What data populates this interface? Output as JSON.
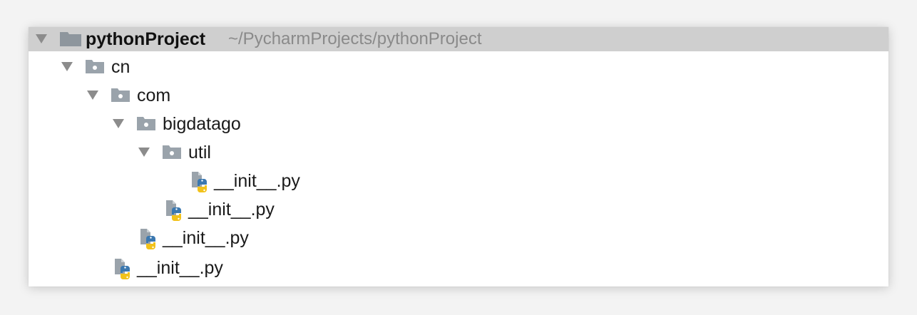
{
  "project_tree": {
    "root": {
      "name": "pythonProject",
      "path": "~/PycharmProjects/pythonProject",
      "expanded": true
    },
    "nodes": [
      {
        "type": "folder",
        "name": "cn",
        "expanded": true
      },
      {
        "type": "folder",
        "name": "com",
        "expanded": true
      },
      {
        "type": "folder",
        "name": "bigdatago",
        "expanded": true
      },
      {
        "type": "folder",
        "name": "util",
        "expanded": true
      },
      {
        "type": "python-file",
        "name": "__init__.py"
      },
      {
        "type": "python-file",
        "name": "__init__.py"
      },
      {
        "type": "python-file",
        "name": "__init__.py"
      },
      {
        "type": "python-file",
        "name": "__init__.py"
      }
    ]
  },
  "colors": {
    "selected_row_bg": "#cfcfcf",
    "folder_icon": "#9aa3ab",
    "path_text": "#8a8a8a",
    "python_blue": "#3b78b0",
    "python_yellow": "#f2c21b"
  }
}
